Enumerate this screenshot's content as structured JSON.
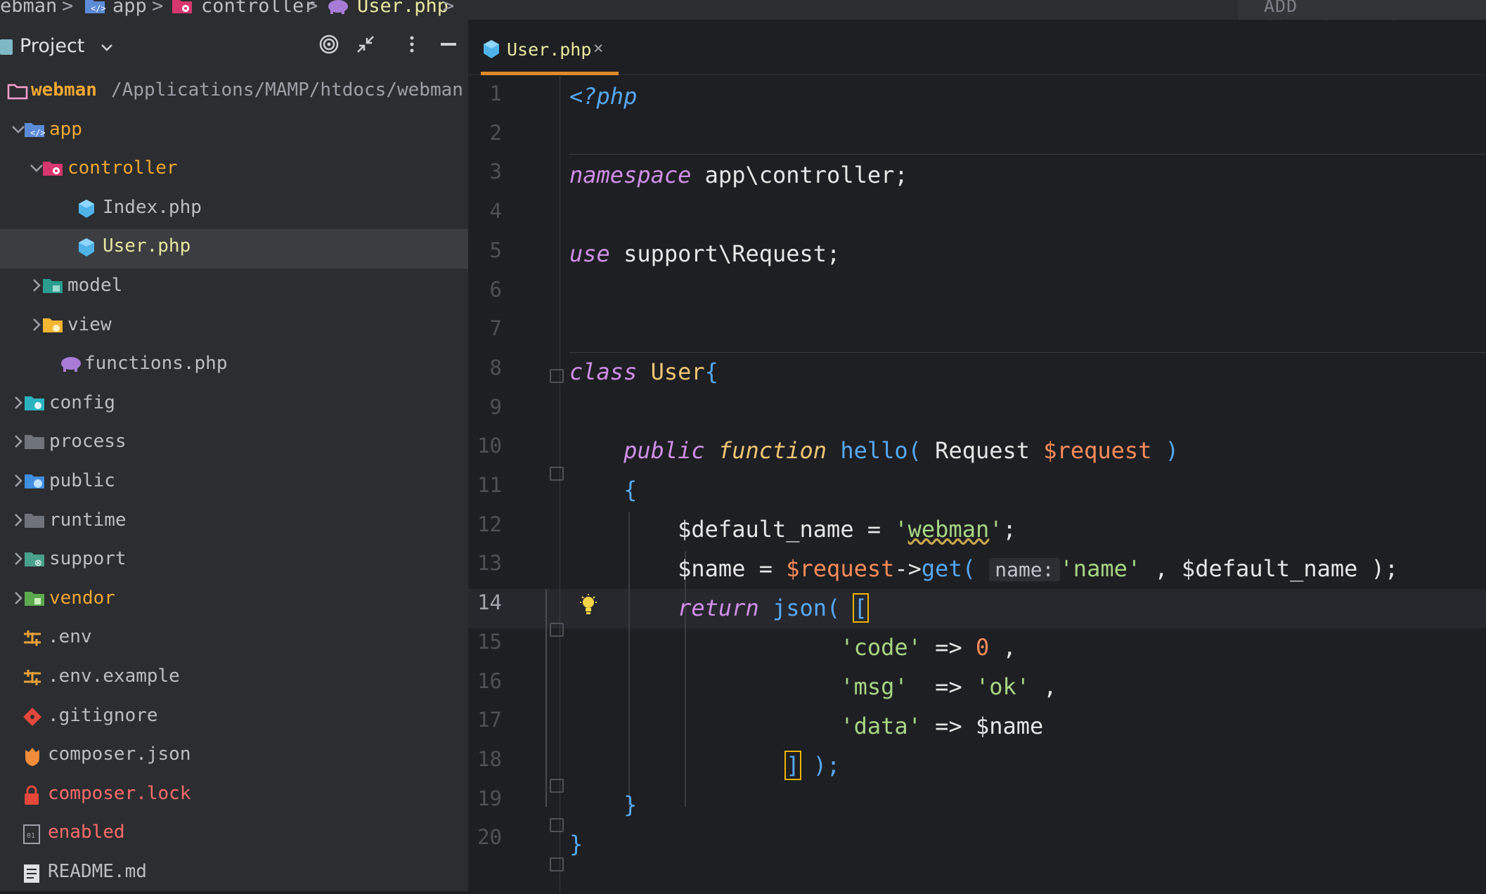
{
  "breadcrumb": {
    "project": "ebman",
    "items": [
      "app",
      "controller",
      "User.php"
    ],
    "sep": ">"
  },
  "run_config": {
    "label": "ADD CONFIGURATION..."
  },
  "project_panel": {
    "title": "Project",
    "root": {
      "name": "webman",
      "path": "/Applications/MAMP/htdocs/webman"
    },
    "tree": [
      {
        "label": "app",
        "color": "#f0a732",
        "icon": "source-folder-icon",
        "chev": "down"
      },
      {
        "label": "controller",
        "color": "#f0a732",
        "icon": "controller-folder-icon",
        "chev": "down"
      },
      {
        "label": "Index.php",
        "color": "#bcbec4",
        "icon": "php-class-icon"
      },
      {
        "label": "User.php",
        "color": "#e8e8a0",
        "icon": "php-class-icon",
        "selected": true
      },
      {
        "label": "model",
        "color": "#bcbec4",
        "icon": "model-folder-icon",
        "chev": "right"
      },
      {
        "label": "view",
        "color": "#bcbec4",
        "icon": "view-folder-icon",
        "chev": "right"
      },
      {
        "label": "functions.php",
        "color": "#bcbec4",
        "icon": "php-elephant-icon"
      },
      {
        "label": "config",
        "color": "#bcbec4",
        "icon": "config-folder-icon",
        "chev": "right"
      },
      {
        "label": "process",
        "color": "#bcbec4",
        "icon": "folder-icon",
        "chev": "right"
      },
      {
        "label": "public",
        "color": "#bcbec4",
        "icon": "web-folder-icon",
        "chev": "right"
      },
      {
        "label": "runtime",
        "color": "#bcbec4",
        "icon": "folder-icon",
        "chev": "right"
      },
      {
        "label": "support",
        "color": "#bcbec4",
        "icon": "support-folder-icon",
        "chev": "right"
      },
      {
        "label": "vendor",
        "color": "#f0a732",
        "icon": "vendor-folder-icon",
        "chev": "right"
      },
      {
        "label": ".env",
        "color": "#bcbec4",
        "icon": "env-icon"
      },
      {
        "label": ".env.example",
        "color": "#bcbec4",
        "icon": "env-icon"
      },
      {
        "label": ".gitignore",
        "color": "#bcbec4",
        "icon": "git-icon"
      },
      {
        "label": "composer.json",
        "color": "#bcbec4",
        "icon": "composer-icon"
      },
      {
        "label": "composer.lock",
        "color": "#ff6b6b",
        "icon": "lock-icon"
      },
      {
        "label": "enabled",
        "color": "#ff6b6b",
        "icon": "binary-file-icon"
      },
      {
        "label": "README.md",
        "color": "#bcbec4",
        "icon": "markdown-icon"
      }
    ]
  },
  "editor": {
    "tab": {
      "label": "User.php",
      "close": "×"
    },
    "line_numbers": [
      "1",
      "2",
      "3",
      "4",
      "5",
      "6",
      "7",
      "8",
      "9",
      "10",
      "11",
      "12",
      "13",
      "14",
      "15",
      "16",
      "17",
      "18",
      "19",
      "20"
    ],
    "current_line": 14,
    "code": {
      "l1": "<?php",
      "l3_kw": "namespace",
      "l3_rest": " app\\controller;",
      "l5_kw": "use",
      "l5_rest": " support\\Request;",
      "l8_kw": "class",
      "l8_name": " User",
      "l8_brace": "{",
      "l10_kw1": "public",
      "l10_kw2": "function",
      "l10_fn": "hello",
      "l10_p1": "( ",
      "l10_type": "Request ",
      "l10_var": "$request",
      "l10_p2": " )",
      "l11": "{",
      "l12_var": "$default_name",
      "l12_eq": " = ",
      "l12_q1": "'",
      "l12_str": "webman",
      "l12_q2": "'",
      "l12_end": ";",
      "l13_var": "$name",
      "l13_eq": " = ",
      "l13_req": "$request",
      "l13_arrow": "->",
      "l13_fn": "get",
      "l13_p": "( ",
      "l13_hint": "name:",
      "l13_str": "'name'",
      "l13_comma": " , ",
      "l13_var2": "$default_name",
      "l13_end": " );",
      "l14_kw": "return",
      "l14_fn": "json",
      "l14_p": "( ",
      "l14_br": "[",
      "l15_str": "'code'",
      "l15_arrow": " => ",
      "l15_num": "0",
      "l15_comma": " ,",
      "l16_str": "'msg'",
      "l16_arrow": "  => ",
      "l16_val": "'ok'",
      "l16_comma": " ,",
      "l17_str": "'data'",
      "l17_arrow": " => ",
      "l17_var": "$name",
      "l18_br": "]",
      "l18_end": " );",
      "l19": "}",
      "l20": "}"
    }
  }
}
